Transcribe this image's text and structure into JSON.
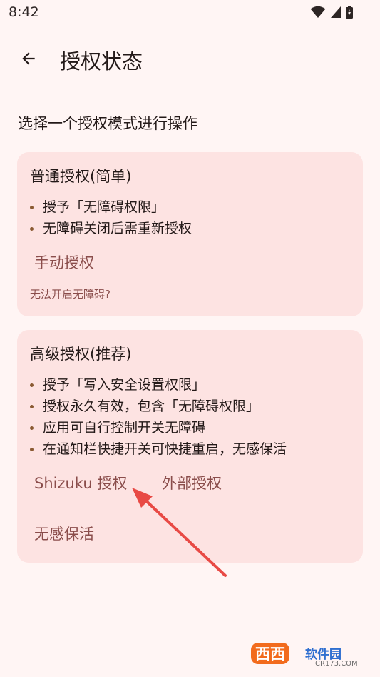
{
  "status_bar": {
    "time": "8:42"
  },
  "app_bar": {
    "title": "授权状态",
    "back_icon": "arrow-back-icon"
  },
  "subtitle": "选择一个授权模式进行操作",
  "cards": [
    {
      "title": "普通授权(简单)",
      "bullets": [
        "授予「无障碍权限」",
        "无障碍关闭后需重新授权"
      ],
      "buttons": [
        "手动授权"
      ],
      "help": "无法开启无障碍?"
    },
    {
      "title": "高级授权(推荐)",
      "bullets": [
        "授予「写入安全设置权限」",
        "授权永久有效，包含「无障碍权限」",
        "应用可自行控制开关无障碍",
        "在通知栏快捷开关可快捷重启，无感保活"
      ],
      "buttons": [
        "Shizuku 授权",
        "外部授权",
        "无感保活"
      ]
    }
  ],
  "watermark": {
    "badge": "西西",
    "name": "软件园",
    "url": "CR173.COM"
  },
  "colors": {
    "background": "#fff5f4",
    "card": "#fde3e2",
    "accent": "#8a4d4b",
    "bullet": "#8a5a32",
    "annotation_arrow": "#e84a45"
  }
}
